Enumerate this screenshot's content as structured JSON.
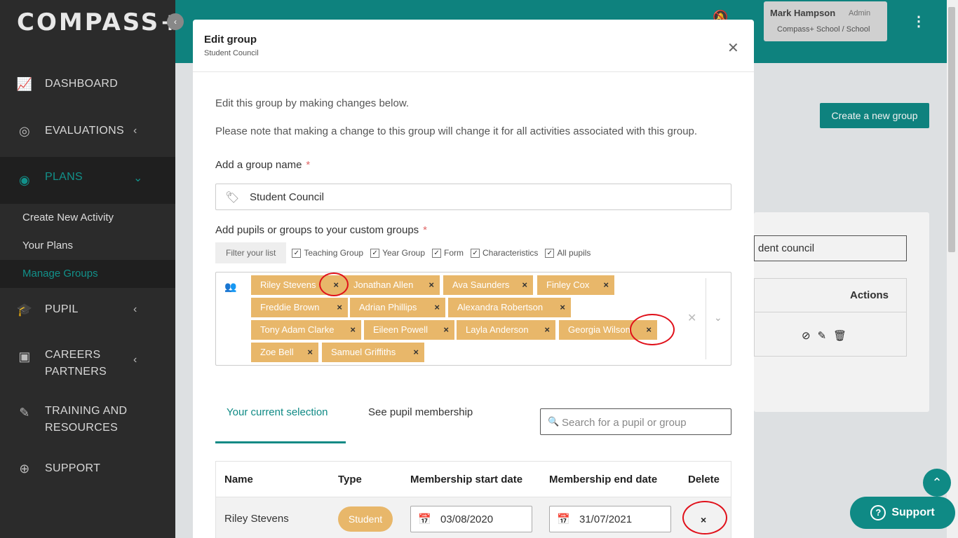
{
  "app": {
    "logo": "COMPASS+"
  },
  "sidebar": {
    "items": [
      {
        "label": "DASHBOARD",
        "icon": "chart-icon"
      },
      {
        "label": "EVALUATIONS",
        "icon": "compass-icon"
      },
      {
        "label": "PLANS",
        "icon": "target-icon"
      },
      {
        "label": "PUPIL",
        "icon": "graduation-cap-icon"
      },
      {
        "label": "CAREERS PARTNERS",
        "icon": "id-card-icon"
      },
      {
        "label": "TRAINING AND RESOURCES",
        "icon": "pencil-icon"
      },
      {
        "label": "SUPPORT",
        "icon": "lifebuoy-icon"
      }
    ],
    "sub_items": [
      "Create New Activity",
      "Your Plans",
      "Manage Groups"
    ]
  },
  "user": {
    "name": "Mark Hampson",
    "role": "Admin",
    "school": "Compass+ School",
    "school_type": "/ School"
  },
  "page": {
    "create_button": "Create a new group",
    "search_value": "dent council",
    "actions_header": "Actions"
  },
  "modal": {
    "title": "Edit group",
    "subtitle": "Student Council",
    "intro": "Edit this group by making changes below.",
    "note": "Please note that making a change to this group will change it for all activities associated with this group.",
    "name_label": "Add a group name",
    "name_value": "Student Council",
    "pupils_label": "Add pupils or groups to your custom groups",
    "required_mark": "*",
    "filter_button": "Filter your list",
    "filters": [
      "Teaching Group",
      "Year Group",
      "Form",
      "Characteristics",
      "All pupils"
    ],
    "tags": [
      "Riley Stevens",
      "Jonathan Allen",
      "Ava Saunders",
      "Finley Cox",
      "Freddie Brown",
      "Adrian Phillips",
      "Alexandra Robertson",
      "Tony Adam Clarke",
      "Eileen Powell",
      "Layla Anderson",
      "Georgia Wilson",
      "Zoe Bell",
      "Samuel Griffiths"
    ],
    "tabs": [
      "Your current selection",
      "See pupil membership"
    ],
    "search_placeholder": "Search for a pupil or group",
    "table": {
      "headers": [
        "Name",
        "Type",
        "Membership start date",
        "Membership end date",
        "Delete"
      ],
      "rows": [
        {
          "name": "Riley Stevens",
          "type": "Student",
          "start": "03/08/2020",
          "end": "31/07/2021"
        }
      ]
    }
  },
  "support_button": "Support",
  "colors": {
    "teal": "#0f8a85",
    "tag": "#e8b76a",
    "sidebar": "#2b2b2b",
    "highlight": "#e0101a"
  }
}
